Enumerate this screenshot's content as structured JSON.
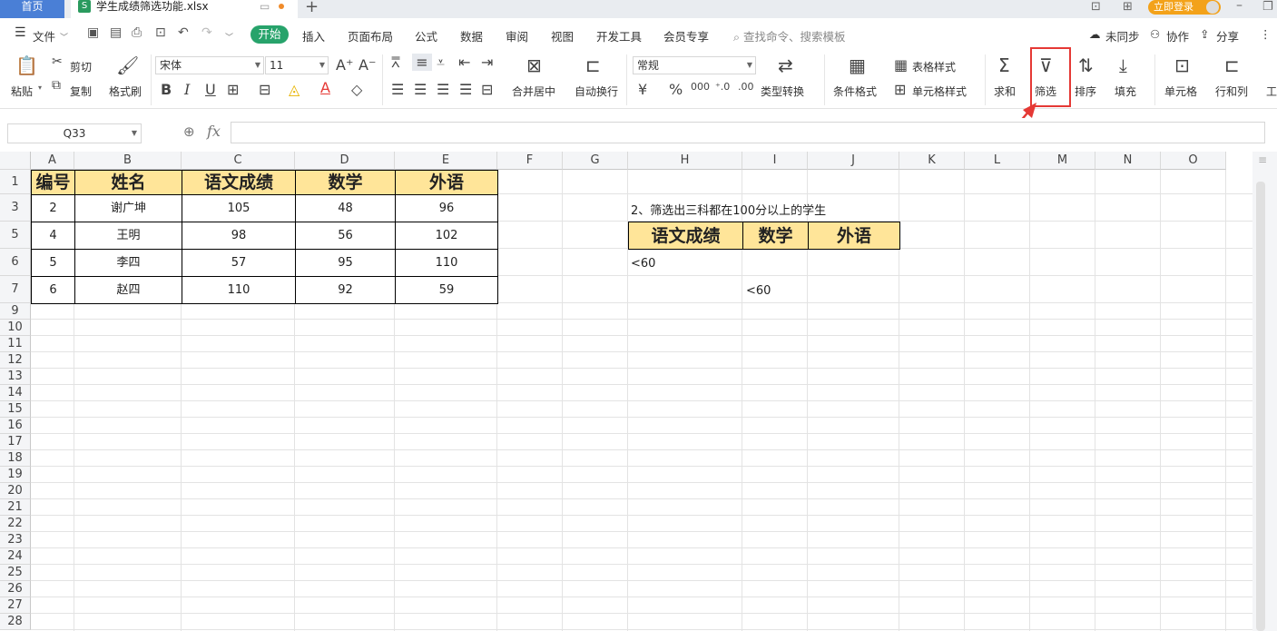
{
  "titlebar": {
    "home_tab": "首页",
    "file_tab": "学生成绩筛选功能.xlsx",
    "file_icon": "S",
    "new_tab": "+",
    "login": "立即登录"
  },
  "menubar": {
    "file_menu": "文件",
    "tabs": [
      "开始",
      "插入",
      "页面布局",
      "公式",
      "数据",
      "审阅",
      "视图",
      "开发工具",
      "会员专享"
    ],
    "search": "查找命令、搜索模板",
    "not_synced": "未同步",
    "collab": "协作",
    "share": "分享"
  },
  "ribbon": {
    "paste": "粘贴",
    "cut": "剪切",
    "copy": "复制",
    "format_painter": "格式刷",
    "font_name": "宋体",
    "font_size": "11",
    "merge_center": "合并居中",
    "wrap_text": "自动换行",
    "number_format": "常规",
    "type_convert": "类型转换",
    "cond_format": "条件格式",
    "table_style": "表格样式",
    "cell_style": "单元格样式",
    "sum": "求和",
    "filter": "筛选",
    "sort": "排序",
    "fill": "填充",
    "cell": "单元格",
    "row_col": "行和列",
    "worksheet": "工"
  },
  "formula_bar": {
    "name_box": "Q33",
    "fx": "fx",
    "content": ""
  },
  "sheet": {
    "columns": [
      "A",
      "B",
      "C",
      "D",
      "E",
      "F",
      "G",
      "H",
      "I",
      "J",
      "K",
      "L",
      "M",
      "N",
      "O"
    ],
    "rows": [
      "1",
      "3",
      "5",
      "6",
      "7",
      "9",
      "10",
      "11",
      "12",
      "13",
      "14",
      "15",
      "16",
      "17",
      "18",
      "19",
      "20",
      "21",
      "22",
      "23",
      "24",
      "25",
      "26",
      "27",
      "28"
    ],
    "table_header": [
      "编号",
      "姓名",
      "语文成绩",
      "数学",
      "外语"
    ],
    "table_rows": [
      [
        "2",
        "谢广坤",
        "105",
        "48",
        "96"
      ],
      [
        "4",
        "王明",
        "98",
        "56",
        "102"
      ],
      [
        "5",
        "李四",
        "57",
        "95",
        "110"
      ],
      [
        "6",
        "赵四",
        "110",
        "92",
        "59"
      ]
    ],
    "criteria_title": "2、筛选出三科都在100分以上的学生",
    "criteria_header": [
      "语文成绩",
      "数学",
      "外语"
    ],
    "criteria_h6": "<60",
    "criteria_i7": "<60"
  }
}
